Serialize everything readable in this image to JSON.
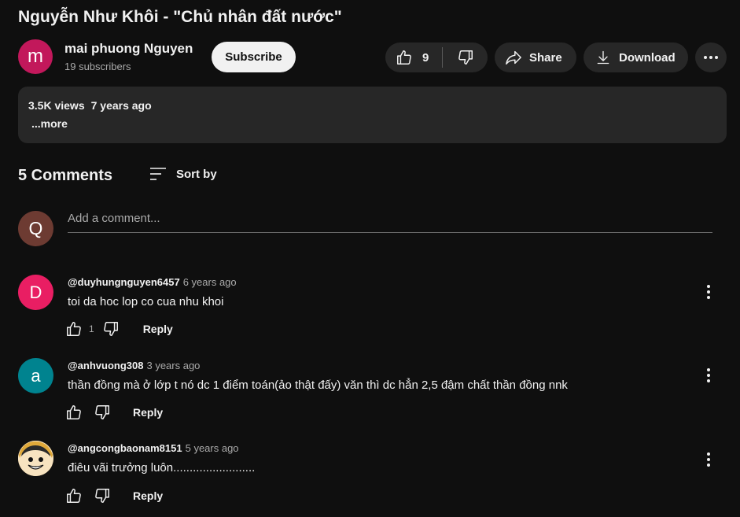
{
  "video": {
    "title": "Nguyễn Như Khôi - \"Chủ nhân đất nước\""
  },
  "channel": {
    "avatar_letter": "m",
    "avatar_color": "#c2185b",
    "name": "mai phuong Nguyen",
    "subscribers": "19 subscribers",
    "subscribe_label": "Subscribe"
  },
  "actions": {
    "like_count": "9",
    "share_label": "Share",
    "download_label": "Download"
  },
  "description": {
    "views": "3.5K views",
    "age": "7 years ago",
    "more_label": "...more"
  },
  "comments_section": {
    "count_label": "5 Comments",
    "sort_label": "Sort by",
    "user_avatar_letter": "Q",
    "add_placeholder": "Add a comment..."
  },
  "comments": [
    {
      "avatar_letter": "D",
      "avatar_color": "#e91e63",
      "author": "@duyhungnguyen6457",
      "time": "6 years ago",
      "text": "toi da hoc lop co cua nhu khoi",
      "like_count": "1",
      "reply_label": "Reply"
    },
    {
      "avatar_letter": "a",
      "avatar_color": "#00838f",
      "author": "@anhvuong308",
      "time": "3 years ago",
      "text": "thần đồng mà ở lớp t nó dc 1 điểm toán(ảo thật đấy) văn thì dc hẳn 2,5 đậm chất thần đồng nnk",
      "like_count": "",
      "reply_label": "Reply"
    },
    {
      "avatar_letter": "",
      "avatar_color": "#f4c27a",
      "author": "@angcongbaonam8151",
      "time": "5 years ago",
      "text": "điêu vãi trưởng luôn.........................",
      "like_count": "",
      "reply_label": "Reply"
    }
  ]
}
